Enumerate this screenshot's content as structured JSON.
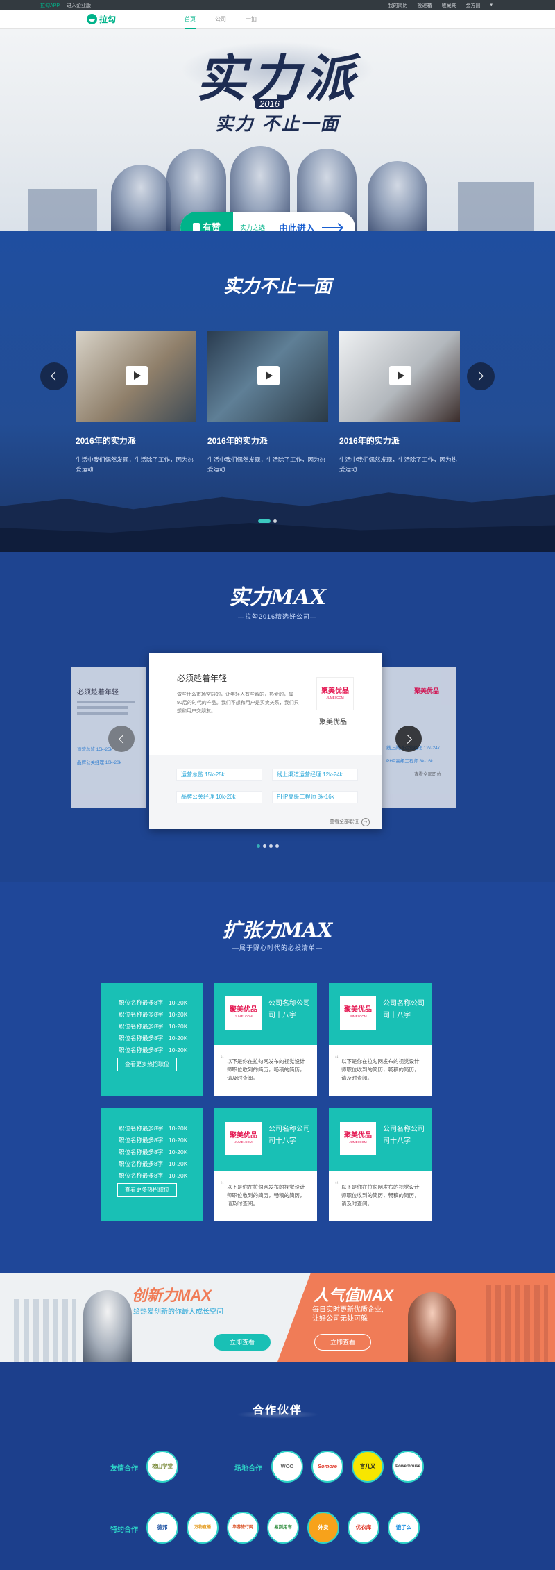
{
  "topbar": {
    "app_link": "拉勾APP",
    "enterprise_link": "进入企业版",
    "right_links": [
      "我的简历",
      "投递箱",
      "收藏夹",
      "金方圆"
    ]
  },
  "nav": {
    "logo_text": "拉勾",
    "links": [
      "首页",
      "公司",
      "一拍"
    ],
    "active_index": 0
  },
  "hero": {
    "title": "实力派",
    "year": "2016",
    "subtitle": "实力 不止一面",
    "cta_badge": "有赞",
    "cta_choice": "实力之选",
    "cta_enter": "由此进入"
  },
  "section1": {
    "title": "实力不止一面",
    "videos": [
      {
        "title": "2016年的实力派",
        "desc": "生活中我们偶然发现，生活除了工作，因为热爱运动……"
      },
      {
        "title": "2016年的实力派",
        "desc": "生活中我们偶然发现，生活除了工作，因为热爱运动……"
      },
      {
        "title": "2016年的实力派",
        "desc": "生活中我们偶然发现，生活除了工作，因为热爱运动……"
      }
    ]
  },
  "section2": {
    "title": "实力MAX",
    "subtitle": "—拉勾2016精选好公司—",
    "card": {
      "title": "必须趁着年轻",
      "desc": "做些什么市场空缺的，让年轻人有些留的，热爱的，属于90后的时代的产品。我们不想和用户是买卖关系，我们只想和用户交朋友。",
      "company_logo": "聚美优品",
      "company_logo_sub": "JUMEI.COM",
      "company_name": "聚美优品",
      "jobs": [
        "运营总监 15k-25k",
        "线上渠道运营经理 12k-24k",
        "品牌公关经理 10k-20k",
        "PHP高级工程师 8k-16k"
      ],
      "more": "查看全部职位"
    },
    "side_left": {
      "title": "必须趁着年轻",
      "tags": [
        "运营总监 15k-25k",
        "品牌公关经理 10k-20k"
      ]
    },
    "side_right": {
      "logo": "聚美优品",
      "tags": [
        "线上渠道运营经理 12k-24k",
        "PHP高级工程师 8k-16k"
      ],
      "more": "查看全部职位"
    }
  },
  "section3": {
    "title": "扩张力MAX",
    "subtitle": "—属于野心时代的必投清单—",
    "job_rows": [
      {
        "name": "职位名称最多8字",
        "salary": "10-20K"
      },
      {
        "name": "职位名称最多8字",
        "salary": "10-20K"
      },
      {
        "name": "职位名称最多8字",
        "salary": "10-20K"
      },
      {
        "name": "职位名称最多8字",
        "salary": "10-20K"
      },
      {
        "name": "职位名称最多8字",
        "salary": "10-20K"
      }
    ],
    "job_button": "查看更多热招职位",
    "company": {
      "logo": "聚美优品",
      "logo_sub": "JUMEI.COM",
      "name": "公司名称公司司十八字",
      "quote": "以下是你在拉勾网发布的视觉设计师职位收到的简历，畅稿的简历，请及时查阅。"
    }
  },
  "banner": {
    "left_title": "创新力MAX",
    "left_sub": "给热爱创新的你最大成长空间",
    "left_button": "立即查看",
    "right_title": "人气值MAX",
    "right_sub_1": "每日实时更新优质企业,",
    "right_sub_2": "让好公司无处可躲",
    "right_button": "立即查看"
  },
  "partners": {
    "title": "合作伙伴",
    "friend_label": "友情合作",
    "venue_label": "场地合作",
    "special_label": "特约合作",
    "friend": [
      "棉山学堂"
    ],
    "venue": [
      "WOO",
      "Somore",
      "言几又",
      "Powerhouse"
    ],
    "special": [
      "德邦",
      "万物直播",
      "华游旅行网",
      "易到用车",
      "外卖",
      "优衣库",
      "饿了么"
    ]
  }
}
